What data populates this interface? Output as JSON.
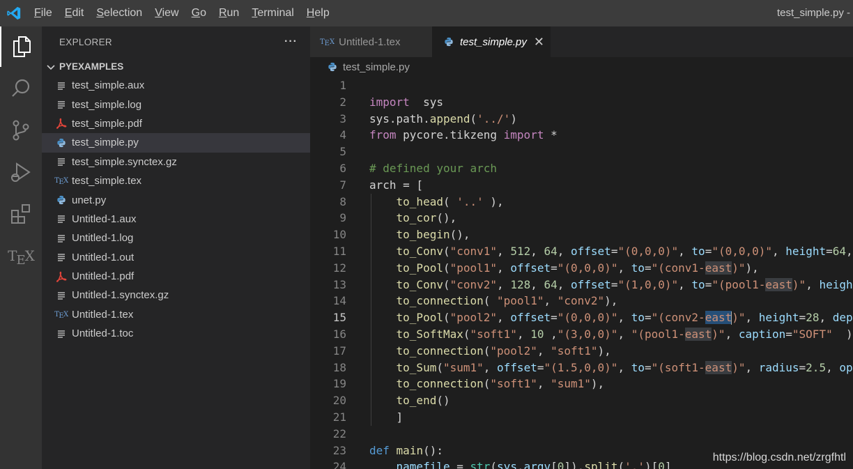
{
  "titlebar": {
    "menu": [
      "File",
      "Edit",
      "Selection",
      "View",
      "Go",
      "Run",
      "Terminal",
      "Help"
    ],
    "window_title": "test_simple.py -"
  },
  "activitybar": {
    "icons": [
      "explorer-icon",
      "search-icon",
      "source-control-icon",
      "run-debug-icon",
      "extensions-icon",
      "tex-icon"
    ],
    "tex_label": [
      "T",
      "E",
      "X"
    ]
  },
  "sidebar": {
    "title": "EXPLORER",
    "more": "···",
    "folder": "PYEXAMPLES",
    "files": [
      {
        "name": "test_simple.aux",
        "icon": "lines"
      },
      {
        "name": "test_simple.log",
        "icon": "lines"
      },
      {
        "name": "test_simple.pdf",
        "icon": "pdf"
      },
      {
        "name": "test_simple.py",
        "icon": "python",
        "selected": true
      },
      {
        "name": "test_simple.synctex.gz",
        "icon": "lines"
      },
      {
        "name": "test_simple.tex",
        "icon": "tex"
      },
      {
        "name": "unet.py",
        "icon": "python"
      },
      {
        "name": "Untitled-1.aux",
        "icon": "lines"
      },
      {
        "name": "Untitled-1.log",
        "icon": "lines"
      },
      {
        "name": "Untitled-1.out",
        "icon": "lines"
      },
      {
        "name": "Untitled-1.pdf",
        "icon": "pdf"
      },
      {
        "name": "Untitled-1.synctex.gz",
        "icon": "lines"
      },
      {
        "name": "Untitled-1.tex",
        "icon": "tex"
      },
      {
        "name": "Untitled-1.toc",
        "icon": "lines"
      }
    ]
  },
  "editor": {
    "tabs": [
      {
        "label": "Untitled-1.tex",
        "active": false
      },
      {
        "label": "test_simple.py",
        "active": true
      }
    ],
    "tab_close": "✕",
    "breadcrumb": "test_simple.py",
    "current_line": 15,
    "lines": [
      [],
      [
        [
          "kw",
          "import"
        ],
        [
          "",
          "  sys"
        ]
      ],
      [
        [
          "",
          "sys.path."
        ],
        [
          "fn",
          "append"
        ],
        [
          "",
          "("
        ],
        [
          "str",
          "'../'"
        ],
        [
          "",
          ")"
        ]
      ],
      [
        [
          "kw",
          "from"
        ],
        [
          "",
          "",
          " pycore.tikzeng "
        ],
        [
          "kw",
          "import"
        ],
        [
          "",
          " *"
        ]
      ],
      [],
      [
        [
          "cm",
          "# defined your arch"
        ]
      ],
      [
        [
          "",
          "arch = ["
        ]
      ],
      [
        [
          "",
          "    "
        ],
        [
          "fn",
          "to_head"
        ],
        [
          "",
          "( "
        ],
        [
          "str",
          "'..'"
        ],
        [
          "",
          " ),"
        ]
      ],
      [
        [
          "",
          "    "
        ],
        [
          "fn",
          "to_cor"
        ],
        [
          "",
          "(),"
        ]
      ],
      [
        [
          "",
          "    "
        ],
        [
          "fn",
          "to_begin"
        ],
        [
          "",
          "(),"
        ]
      ],
      [
        [
          "",
          "    "
        ],
        [
          "fn",
          "to_Conv"
        ],
        [
          "",
          "("
        ],
        [
          "str",
          "\"conv1\""
        ],
        [
          "",
          ", "
        ],
        [
          "num",
          "512"
        ],
        [
          "",
          ", "
        ],
        [
          "num",
          "64"
        ],
        [
          "",
          ", "
        ],
        [
          "par",
          "offset"
        ],
        [
          "",
          "="
        ],
        [
          "str",
          "\"(0,0,0)\""
        ],
        [
          "",
          ", "
        ],
        [
          "par",
          "to"
        ],
        [
          "",
          "="
        ],
        [
          "str",
          "\"(0,0,0)\""
        ],
        [
          "",
          ", "
        ],
        [
          "par",
          "height"
        ],
        [
          "",
          "="
        ],
        [
          "num",
          "64"
        ],
        [
          "",
          ","
        ]
      ],
      [
        [
          "",
          "    "
        ],
        [
          "fn",
          "to_Pool"
        ],
        [
          "",
          "("
        ],
        [
          "str",
          "\"pool1\""
        ],
        [
          "",
          ", "
        ],
        [
          "par",
          "offset"
        ],
        [
          "",
          "="
        ],
        [
          "str",
          "\"(0,0,0)\""
        ],
        [
          "",
          ", "
        ],
        [
          "par",
          "to"
        ],
        [
          "",
          "="
        ],
        [
          "str",
          "\"(conv1-"
        ],
        [
          "strhl",
          "east"
        ],
        [
          "str",
          ")\""
        ],
        [
          "",
          "),"
        ]
      ],
      [
        [
          "",
          "    "
        ],
        [
          "fn",
          "to_Conv"
        ],
        [
          "",
          "("
        ],
        [
          "str",
          "\"conv2\""
        ],
        [
          "",
          ", "
        ],
        [
          "num",
          "128"
        ],
        [
          "",
          ", "
        ],
        [
          "num",
          "64"
        ],
        [
          "",
          ", "
        ],
        [
          "par",
          "offset"
        ],
        [
          "",
          "="
        ],
        [
          "str",
          "\"(1,0,0)\""
        ],
        [
          "",
          ", "
        ],
        [
          "par",
          "to"
        ],
        [
          "",
          "="
        ],
        [
          "str",
          "\"(pool1-"
        ],
        [
          "strhl",
          "east"
        ],
        [
          "str",
          ")\""
        ],
        [
          "",
          ", "
        ],
        [
          "par",
          "heigh"
        ]
      ],
      [
        [
          "",
          "    "
        ],
        [
          "fn",
          "to_connection"
        ],
        [
          "",
          "( "
        ],
        [
          "str",
          "\"pool1\""
        ],
        [
          "",
          ", "
        ],
        [
          "str",
          "\"conv2\""
        ],
        [
          "",
          "),"
        ]
      ],
      [
        [
          "",
          "    "
        ],
        [
          "fn",
          "to_Pool"
        ],
        [
          "",
          "("
        ],
        [
          "str",
          "\"pool2\""
        ],
        [
          "",
          ", "
        ],
        [
          "par",
          "offset"
        ],
        [
          "",
          "="
        ],
        [
          "str",
          "\"(0,0,0)\""
        ],
        [
          "",
          ", "
        ],
        [
          "par",
          "to"
        ],
        [
          "",
          "="
        ],
        [
          "str",
          "\"(conv2-"
        ],
        [
          "strsel",
          "east"
        ],
        [
          "cursor",
          ""
        ],
        [
          "str",
          ")\""
        ],
        [
          "",
          ", "
        ],
        [
          "par",
          "height"
        ],
        [
          "",
          "="
        ],
        [
          "num",
          "28"
        ],
        [
          "",
          ", "
        ],
        [
          "par",
          "dept"
        ]
      ],
      [
        [
          "",
          "    "
        ],
        [
          "fn",
          "to_SoftMax"
        ],
        [
          "",
          "("
        ],
        [
          "str",
          "\"soft1\""
        ],
        [
          "",
          ", "
        ],
        [
          "num",
          "10"
        ],
        [
          "",
          " ,"
        ],
        [
          "str",
          "\"(3,0,0)\""
        ],
        [
          "",
          ", "
        ],
        [
          "str",
          "\"(pool1-"
        ],
        [
          "strhl",
          "east"
        ],
        [
          "str",
          ")\""
        ],
        [
          "",
          ", "
        ],
        [
          "par",
          "caption"
        ],
        [
          "",
          "="
        ],
        [
          "str",
          "\"SOFT\""
        ],
        [
          "",
          "  )"
        ]
      ],
      [
        [
          "",
          "    "
        ],
        [
          "fn",
          "to_connection"
        ],
        [
          "",
          "("
        ],
        [
          "str",
          "\"pool2\""
        ],
        [
          "",
          ", "
        ],
        [
          "str",
          "\"soft1\""
        ],
        [
          "",
          "),"
        ]
      ],
      [
        [
          "",
          "    "
        ],
        [
          "fn",
          "to_Sum"
        ],
        [
          "",
          "("
        ],
        [
          "str",
          "\"sum1\""
        ],
        [
          "",
          ", "
        ],
        [
          "par",
          "offset"
        ],
        [
          "",
          "="
        ],
        [
          "str",
          "\"(1.5,0,0)\""
        ],
        [
          "",
          ", "
        ],
        [
          "par",
          "to"
        ],
        [
          "",
          "="
        ],
        [
          "str",
          "\"(soft1-"
        ],
        [
          "strhl",
          "east"
        ],
        [
          "str",
          ")\""
        ],
        [
          "",
          ", "
        ],
        [
          "par",
          "radius"
        ],
        [
          "",
          "="
        ],
        [
          "num",
          "2.5"
        ],
        [
          "",
          ", "
        ],
        [
          "par",
          "op"
        ]
      ],
      [
        [
          "",
          "    "
        ],
        [
          "fn",
          "to_connection"
        ],
        [
          "",
          "("
        ],
        [
          "str",
          "\"soft1\""
        ],
        [
          "",
          ", "
        ],
        [
          "str",
          "\"sum1\""
        ],
        [
          "",
          "),"
        ]
      ],
      [
        [
          "",
          "    "
        ],
        [
          "fn",
          "to_end"
        ],
        [
          "",
          "()"
        ]
      ],
      [
        [
          "",
          "    ]"
        ]
      ],
      [],
      [
        [
          "kb",
          "def"
        ],
        [
          "",
          " "
        ],
        [
          "fn",
          "main"
        ],
        [
          "",
          "():"
        ]
      ],
      [
        [
          "",
          "    "
        ],
        [
          "par",
          "namefile"
        ],
        [
          "",
          " = "
        ],
        [
          "bi",
          "str"
        ],
        [
          "",
          "("
        ],
        [
          "par",
          "sys"
        ],
        [
          "",
          "."
        ],
        [
          "par",
          "argv"
        ],
        [
          "",
          "["
        ],
        [
          "num",
          "0"
        ],
        [
          "",
          "])."
        ],
        [
          "fn",
          "split"
        ],
        [
          "",
          "("
        ],
        [
          "str",
          "'.'"
        ],
        [
          "",
          ")["
        ],
        [
          "num",
          "0"
        ],
        [
          "",
          "]"
        ]
      ]
    ]
  },
  "watermark": "https://blog.csdn.net/zrgfhtl"
}
